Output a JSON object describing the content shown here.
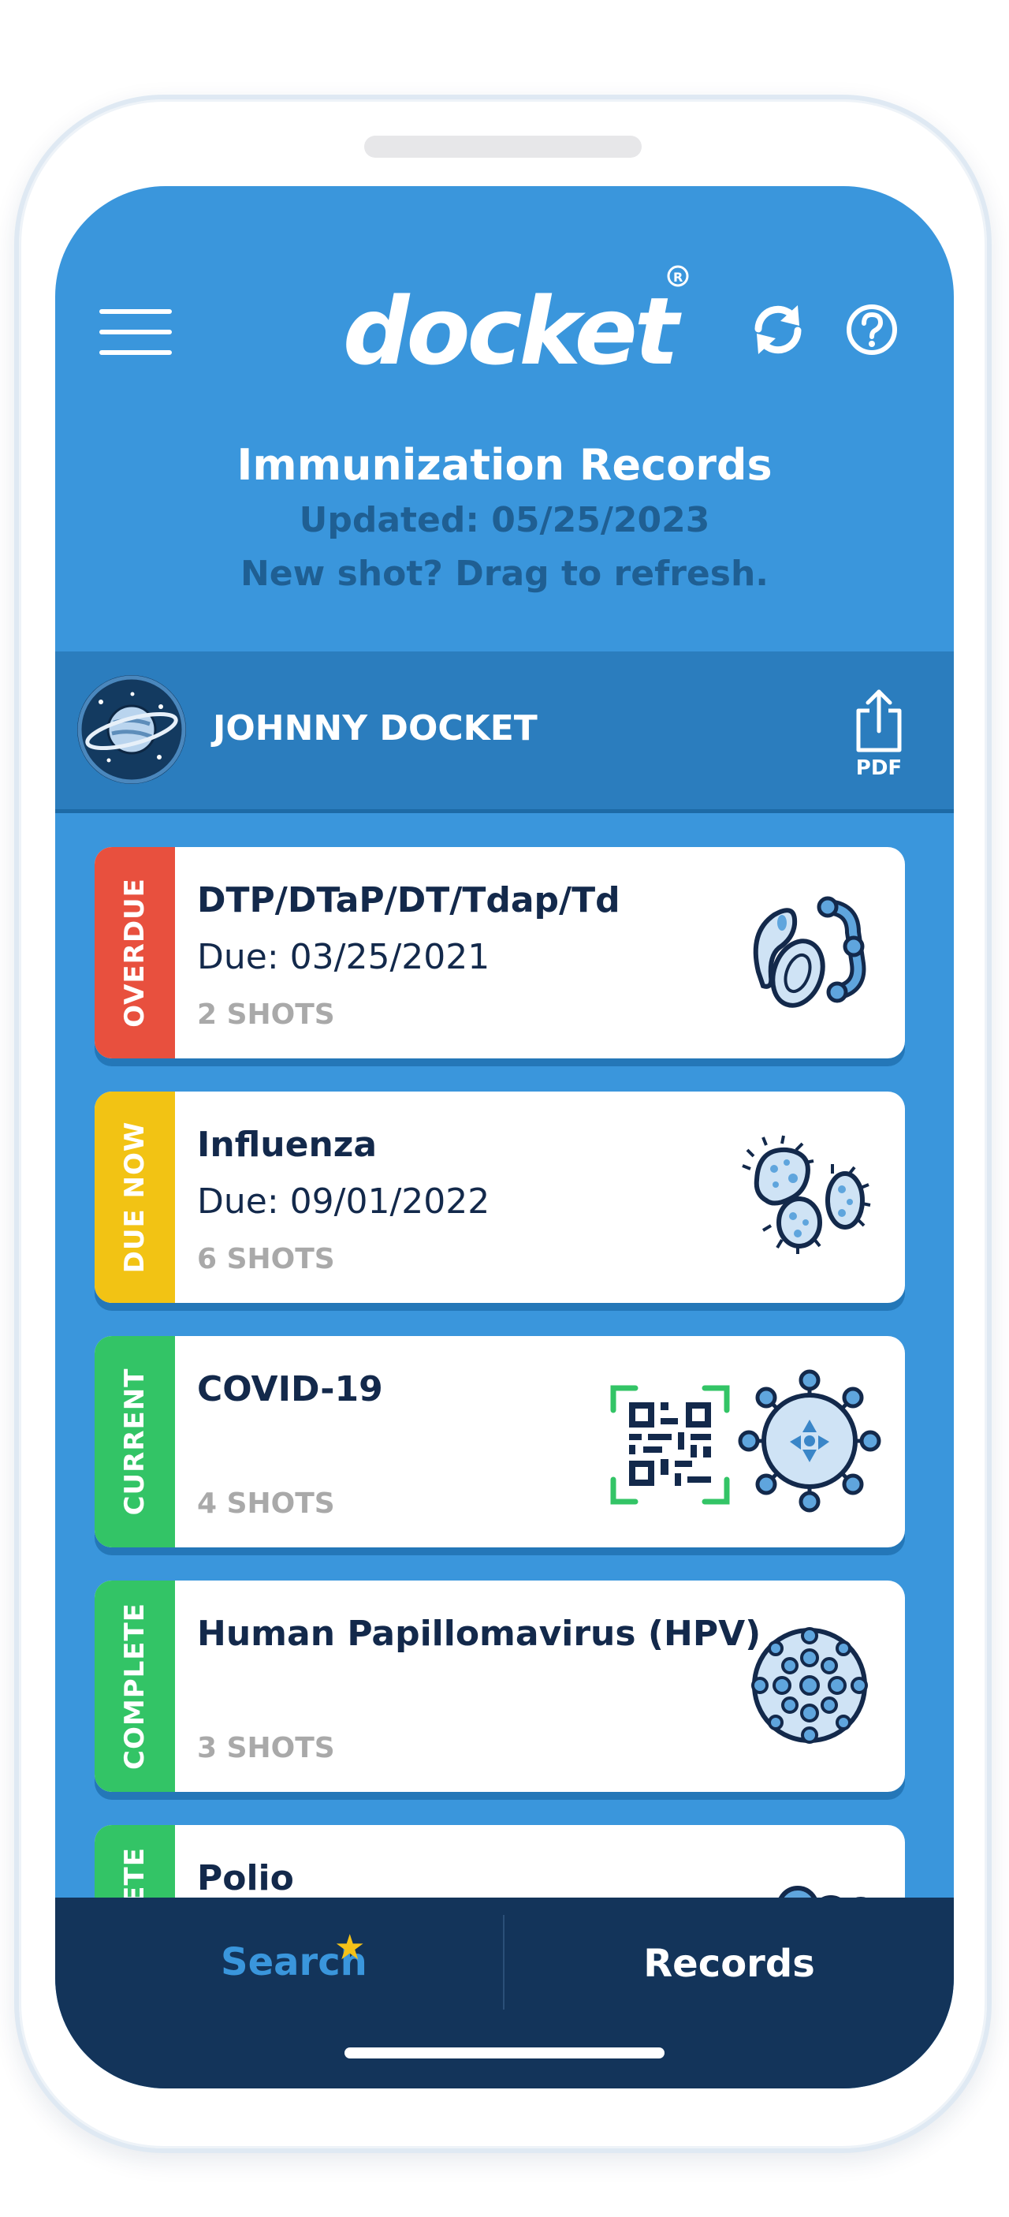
{
  "header": {
    "logo_text": "docket",
    "title": "Immunization Records",
    "updated": "Updated: 05/25/2023",
    "hint": "New shot? Drag to refresh."
  },
  "profile": {
    "name": "JOHNNY DOCKET",
    "export_label": "PDF"
  },
  "records": [
    {
      "status": "OVERDUE",
      "name": "DTP/DTaP/DT/Tdap/Td",
      "due": "Due: 03/25/2021",
      "shots": "2 SHOTS",
      "status_color": "#e8503e",
      "icon": "bacteria-icon"
    },
    {
      "status": "DUE NOW",
      "name": "Influenza",
      "due": "Due: 09/01/2022",
      "shots": "6 SHOTS",
      "status_color": "#f2c314",
      "icon": "influenza-icon"
    },
    {
      "status": "CURRENT",
      "name": "COVID-19",
      "due": "",
      "shots": "4 SHOTS",
      "status_color": "#33c466",
      "icon": "coronavirus-icon"
    },
    {
      "status": "COMPLETE",
      "name": "Human Papillomavirus (HPV)",
      "due": "",
      "shots": "3 SHOTS",
      "status_color": "#33c466",
      "icon": "hpv-virus-icon"
    },
    {
      "status": "COMPLETE",
      "name": "Polio",
      "due": "",
      "shots": "",
      "status_color": "#33c466",
      "icon": "polio-virus-icon"
    }
  ],
  "nav": {
    "search_label": "Search",
    "records_label": "Records"
  },
  "colors": {
    "brand_blue": "#3a96dc",
    "profile_bar": "#2b7dbe",
    "nav_bg": "#13345a",
    "qr_green": "#33c466",
    "star_yellow": "#f5c218"
  }
}
